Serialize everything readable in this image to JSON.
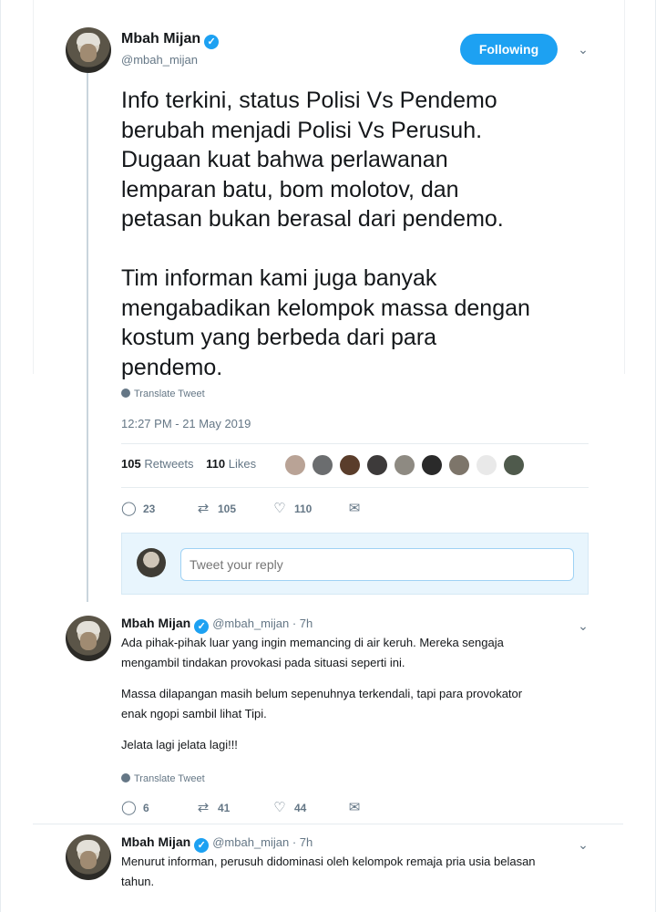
{
  "main_tweet": {
    "author_name": "Mbah Mijan",
    "handle": "@mbah_mijan",
    "follow_label": "Following",
    "text": "Info terkini, status Polisi Vs Pendemo\nberubah menjadi Polisi Vs Perusuh.\nDugaan kuat bahwa perlawanan\nlemparan batu, bom molotov, dan\npetasan bukan berasal dari pendemo.\n\nTim informan kami juga banyak\nmengabadikan kelompok massa dengan\nkostum yang berbeda dari para\npendemo.",
    "translate_label": "Translate Tweet",
    "timestamp": "12:27 PM - 21 May 2019",
    "retweets_count": "105",
    "retweets_label": "Retweets",
    "likes_count": "110",
    "likes_label": "Likes",
    "actions": {
      "replies": "23",
      "retweets": "105",
      "likes": "110"
    }
  },
  "reply_box": {
    "placeholder": "Tweet your reply"
  },
  "replies": [
    {
      "author_name": "Mbah Mijan",
      "handle_time": "@mbah_mijan · 7h",
      "lines": [
        "Ada pihak-pihak luar yang ingin memancing di air keruh. Mereka sengaja",
        "mengambil tindakan provokasi pada situasi seperti ini.",
        "",
        "Massa dilapangan masih belum sepenuhnya terkendali, tapi para provokator",
        "enak ngopi sambil lihat Tipi.",
        "",
        "Jelata lagi jelata lagi!!!"
      ],
      "translate_label": "Translate Tweet",
      "actions": {
        "replies": "6",
        "retweets": "41",
        "likes": "44"
      }
    },
    {
      "author_name": "Mbah Mijan",
      "handle_time": "@mbah_mijan · 7h",
      "lines": [
        "Menurut informan, perusuh didominasi oleh kelompok remaja pria usia belasan",
        "tahun."
      ]
    }
  ],
  "icons": {
    "verified": "verified-badge-icon",
    "chevron": "chevron-down-icon",
    "reply": "reply-icon",
    "retweet": "retweet-icon",
    "like": "heart-icon",
    "dm": "envelope-icon",
    "globe": "globe-icon"
  },
  "colors": {
    "accent": "#1da1f2",
    "muted": "#657786",
    "text": "#14171a"
  }
}
